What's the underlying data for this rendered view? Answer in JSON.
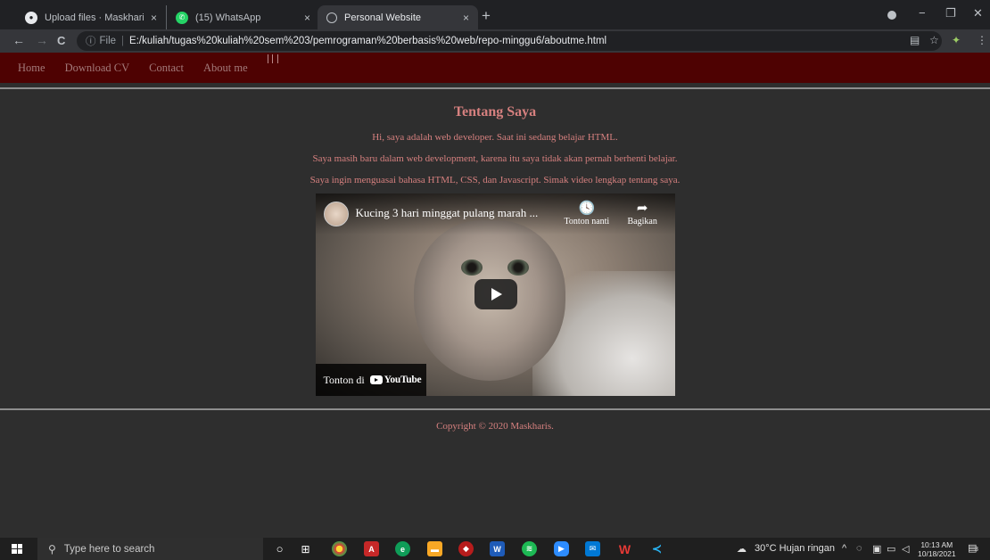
{
  "browser": {
    "tabs": [
      {
        "title": "Upload files · Maskharis/pemrog",
        "close": "×"
      },
      {
        "title": "(15) WhatsApp",
        "close": "×"
      },
      {
        "title": "Personal Website",
        "close": "×"
      }
    ],
    "new_tab": "+",
    "window_controls": {
      "minimize": "−",
      "restore": "❐",
      "close": "✕"
    },
    "nav": {
      "back": "←",
      "forward": "→",
      "reload": "C"
    },
    "omnibox": {
      "scheme_label": "File",
      "url": "E:/kuliah/tugas%20kuliah%20sem%203/pemrograman%20berbasis%20web/repo-minggu6/aboutme.html"
    }
  },
  "site": {
    "nav": [
      "Home",
      "Download CV",
      "Contact",
      "About me"
    ],
    "heading": "Tentang Saya",
    "paragraphs": [
      "Hi, saya adalah web developer. Saat ini sedang belajar HTML.",
      "Saya masih baru dalam web development, karena itu saya tidak akan pernah berhenti belajar.",
      "Saya ingin menguasai bahasa HTML, CSS, dan Javascript. Simak video lengkap tentang saya."
    ],
    "video": {
      "title": "Kucing 3 hari minggat pulang marah ...",
      "watch_later": "Tonton nanti",
      "share": "Bagikan",
      "watch_on": "Tonton di",
      "brand": "YouTube"
    },
    "footer": "Copyright © 2020 Maskharis."
  },
  "taskbar": {
    "search_placeholder": "Type here to search",
    "weather": "30°C  Hujan ringan",
    "time": "10:13 AM",
    "date": "10/18/2021",
    "notifications": "3"
  }
}
